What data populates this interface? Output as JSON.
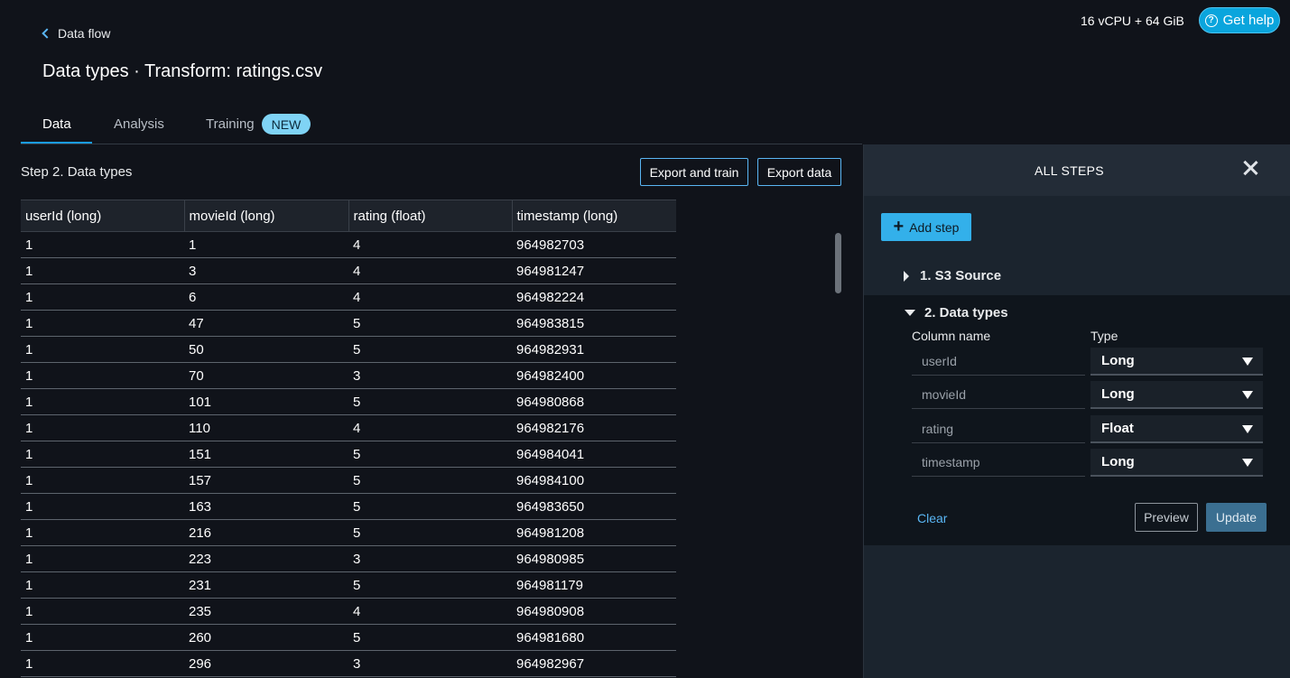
{
  "header": {
    "resource": "16 vCPU + 64 GiB",
    "help_label": "Get help",
    "back_label": "Data flow",
    "title": "Data types · Transform: ratings.csv"
  },
  "tabs": [
    {
      "label": "Data",
      "active": true
    },
    {
      "label": "Analysis",
      "active": false
    },
    {
      "label": "Training",
      "active": false,
      "badge": "NEW"
    }
  ],
  "step": {
    "title": "Step 2. Data types",
    "export_train_label": "Export and train",
    "export_data_label": "Export data"
  },
  "table": {
    "headers": [
      "userId (long)",
      "movieId (long)",
      "rating (float)",
      "timestamp (long)"
    ],
    "rows": [
      [
        "1",
        "1",
        "4",
        "964982703"
      ],
      [
        "1",
        "3",
        "4",
        "964981247"
      ],
      [
        "1",
        "6",
        "4",
        "964982224"
      ],
      [
        "1",
        "47",
        "5",
        "964983815"
      ],
      [
        "1",
        "50",
        "5",
        "964982931"
      ],
      [
        "1",
        "70",
        "3",
        "964982400"
      ],
      [
        "1",
        "101",
        "5",
        "964980868"
      ],
      [
        "1",
        "110",
        "4",
        "964982176"
      ],
      [
        "1",
        "151",
        "5",
        "964984041"
      ],
      [
        "1",
        "157",
        "5",
        "964984100"
      ],
      [
        "1",
        "163",
        "5",
        "964983650"
      ],
      [
        "1",
        "216",
        "5",
        "964981208"
      ],
      [
        "1",
        "223",
        "3",
        "964980985"
      ],
      [
        "1",
        "231",
        "5",
        "964981179"
      ],
      [
        "1",
        "235",
        "4",
        "964980908"
      ],
      [
        "1",
        "260",
        "5",
        "964981680"
      ],
      [
        "1",
        "296",
        "3",
        "964982967"
      ]
    ]
  },
  "panel": {
    "title": "ALL STEPS",
    "add_step_label": "Add step",
    "step1_label": "1. S3 Source",
    "step2_label": "2. Data types",
    "column_name_label": "Column name",
    "type_label": "Type",
    "columns": [
      {
        "name": "userId",
        "type": "Long"
      },
      {
        "name": "movieId",
        "type": "Long"
      },
      {
        "name": "rating",
        "type": "Float"
      },
      {
        "name": "timestamp",
        "type": "Long"
      }
    ],
    "clear_label": "Clear",
    "preview_label": "Preview",
    "update_label": "Update"
  },
  "colors": {
    "accent": "#1a9ce0",
    "background": "#10131a",
    "panel": "#1b242e"
  }
}
